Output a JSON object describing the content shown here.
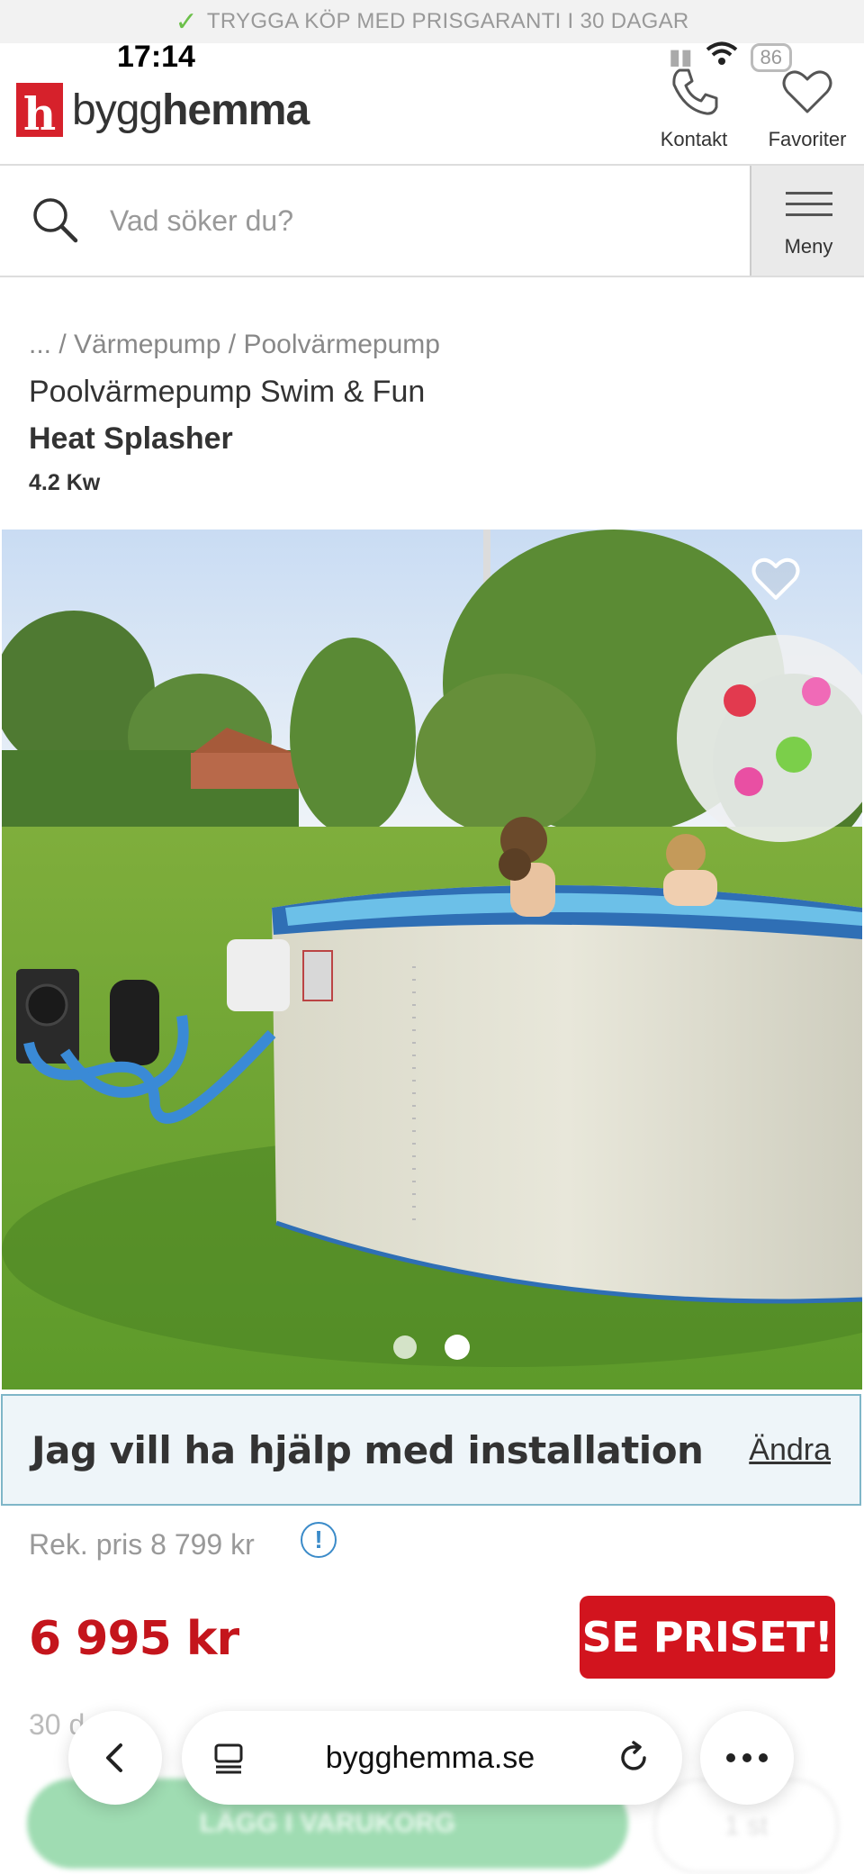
{
  "promo": {
    "text": "TRYGGA KÖP MED PRISGARANTI I 30 DAGAR"
  },
  "status": {
    "time": "17:14",
    "battery": "86"
  },
  "header": {
    "logo_prefix": "bygg",
    "logo_suffix": "hemma",
    "contact_label": "Kontakt",
    "favorites_label": "Favoriter"
  },
  "search": {
    "placeholder": "Vad söker du?",
    "value": ""
  },
  "menu": {
    "label": "Meny"
  },
  "breadcrumb": {
    "ellipsis": "...",
    "separator": "/",
    "items": [
      "Värmepump",
      "Poolvärmepump"
    ]
  },
  "product": {
    "brand_line": "Poolvärmepump Swim & Fun",
    "name": "Heat Splasher",
    "variant": "4.2 Kw",
    "image_count": 2,
    "active_image": 2
  },
  "installation": {
    "label": "Jag vill ha hjälp med installation",
    "change_label": "Ändra"
  },
  "price": {
    "recommended": "Rek. pris 8 799 kr",
    "current": "6 995 kr",
    "cta": "SE PRISET!",
    "days_note": "30 d",
    "add_to_cart": "LÄGG I VARUKORG",
    "quantity": "1 st"
  },
  "browser": {
    "url": "bygghemma.se"
  },
  "colors": {
    "brand_red": "#d6212b",
    "price_red": "#c4151c",
    "cta_red": "#d2141e",
    "accent_blue": "#3b8bc9"
  }
}
